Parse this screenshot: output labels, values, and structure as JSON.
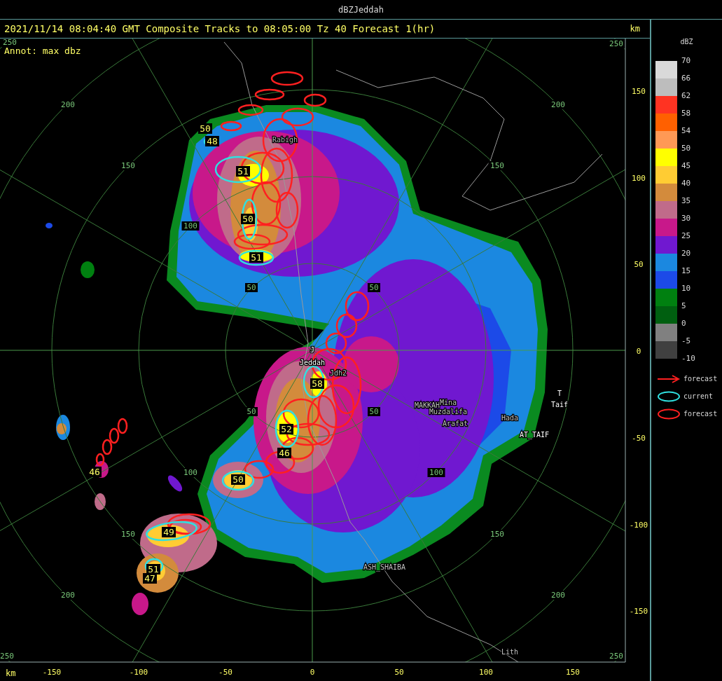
{
  "window": {
    "title": "dBZJeddah"
  },
  "header": {
    "caption": "2021/11/14 08:04:40 GMT Composite Tracks to 08:05:00 Tz 40 Forecast 1(hr)",
    "annotation": "Annot: max dbz",
    "unit_right": "km",
    "unit_bottom": "km"
  },
  "y_axis": [
    "150",
    "100",
    "50",
    "0",
    "-50",
    "-100",
    "-150"
  ],
  "x_axis": [
    "-150",
    "-100",
    "-50",
    "0",
    "50",
    "100",
    "150"
  ],
  "ring_labels": [
    "250",
    "250",
    "250",
    "250",
    "200",
    "200",
    "200",
    "200",
    "150",
    "150",
    "150",
    "150",
    "100",
    "100",
    "100",
    "50",
    "50",
    "50",
    "50"
  ],
  "places": [
    "Rabigh",
    "J",
    "Jeddah",
    "Jdh2",
    "MAKKAH",
    "Mina",
    "Muzdalifa",
    "Arafat",
    "Hada",
    "AT_TAIF",
    "T",
    "Taif",
    "ASH_SHAIBA",
    "Lith"
  ],
  "cells": [
    "50",
    "48",
    "51",
    "50",
    "51",
    "58",
    "52",
    "46",
    "50",
    "46",
    "49",
    "51",
    "47"
  ],
  "legend": {
    "title": "dBZ",
    "bands": [
      {
        "color": "#d9d9d9"
      },
      {
        "color": "#bdbdbd"
      },
      {
        "color": "#ff3322"
      },
      {
        "color": "#ff6000"
      },
      {
        "color": "#ff9955"
      },
      {
        "color": "#ffff00"
      },
      {
        "color": "#ffcc33"
      },
      {
        "color": "#d38b3c"
      },
      {
        "color": "#c06b8a"
      },
      {
        "color": "#c8188a"
      },
      {
        "color": "#7018d0"
      },
      {
        "color": "#1b88e0"
      },
      {
        "color": "#1c4ae8"
      },
      {
        "color": "#008010"
      },
      {
        "color": "#005f10"
      },
      {
        "color": "#808080"
      },
      {
        "color": "#404040"
      }
    ],
    "labels": [
      "70",
      "66",
      "62",
      "58",
      "54",
      "50",
      "45",
      "40",
      "35",
      "30",
      "25",
      "20",
      "15",
      "10",
      "5",
      "0",
      "-5",
      "-10"
    ],
    "tracks": [
      {
        "kind": "arrow",
        "label": "forecast"
      },
      {
        "kind": "current",
        "label": "current"
      },
      {
        "kind": "forecast",
        "label": "forecast"
      }
    ]
  }
}
